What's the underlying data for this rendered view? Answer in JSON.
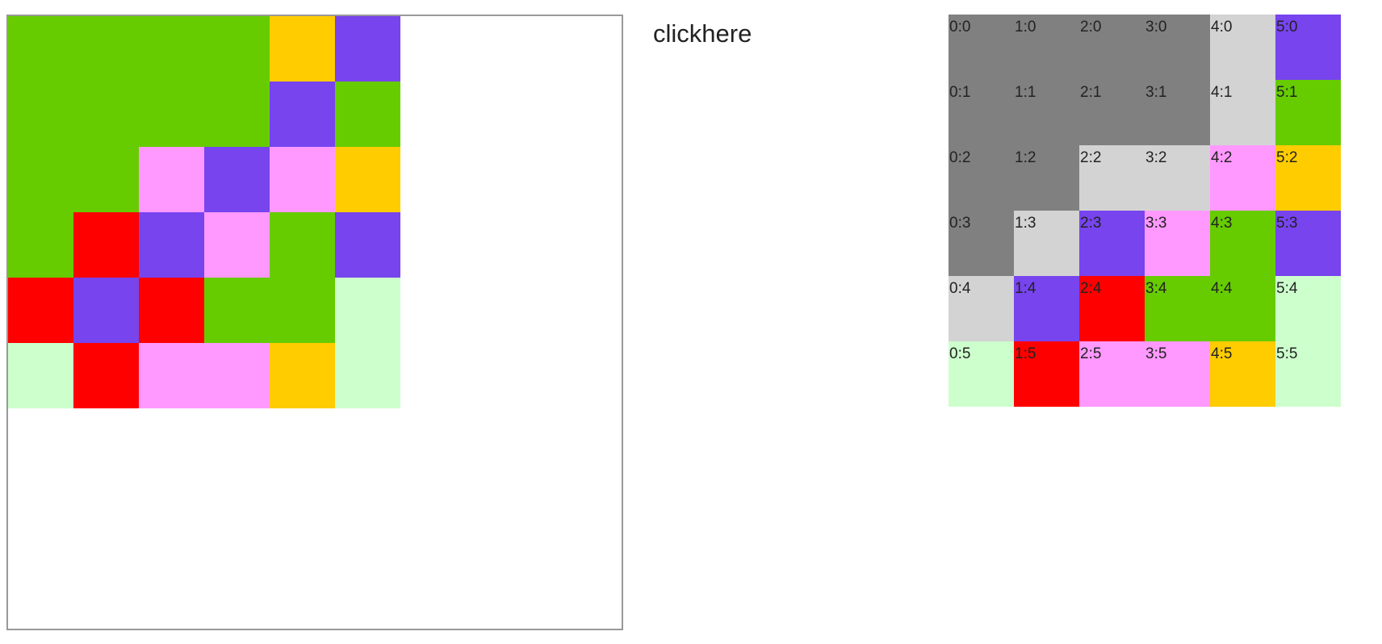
{
  "palette": {
    "green": "#66cc00",
    "yellow": "#ffcc00",
    "purple": "#7744ee",
    "pink": "#ff99ff",
    "red": "#ff0000",
    "mint": "#ccffcc",
    "gray": "#808080",
    "lightgray": "#d3d3d3"
  },
  "board_color_names": [
    [
      "green",
      "green",
      "green",
      "green",
      "yellow",
      "purple"
    ],
    [
      "green",
      "green",
      "green",
      "green",
      "purple",
      "green"
    ],
    [
      "green",
      "green",
      "pink",
      "purple",
      "pink",
      "yellow"
    ],
    [
      "green",
      "red",
      "purple",
      "pink",
      "green",
      "purple"
    ],
    [
      "red",
      "purple",
      "red",
      "green",
      "green",
      "mint"
    ],
    [
      "mint",
      "red",
      "pink",
      "pink",
      "yellow",
      "mint"
    ]
  ],
  "label_grid_color_names": [
    [
      "gray",
      "gray",
      "gray",
      "gray",
      "lightgray",
      "purple"
    ],
    [
      "gray",
      "gray",
      "gray",
      "gray",
      "lightgray",
      "green"
    ],
    [
      "gray",
      "gray",
      "lightgray",
      "lightgray",
      "pink",
      "yellow"
    ],
    [
      "gray",
      "lightgray",
      "purple",
      "pink",
      "green",
      "purple"
    ],
    [
      "lightgray",
      "purple",
      "red",
      "green",
      "green",
      "mint"
    ],
    [
      "mint",
      "red",
      "pink",
      "pink",
      "yellow",
      "mint"
    ]
  ],
  "label_grid_text": [
    [
      "0:0",
      "1:0",
      "2:0",
      "3:0",
      "4:0",
      "5:0"
    ],
    [
      "0:1",
      "1:1",
      "2:1",
      "3:1",
      "4:1",
      "5:1"
    ],
    [
      "0:2",
      "1:2",
      "2:2",
      "3:2",
      "4:2",
      "5:2"
    ],
    [
      "0:3",
      "1:3",
      "2:3",
      "3:3",
      "4:3",
      "5:3"
    ],
    [
      "0:4",
      "1:4",
      "2:4",
      "3:4",
      "4:4",
      "5:4"
    ],
    [
      "0:5",
      "1:5",
      "2:5",
      "3:5",
      "4:5",
      "5:5"
    ]
  ],
  "link": {
    "label": "clickhere"
  }
}
